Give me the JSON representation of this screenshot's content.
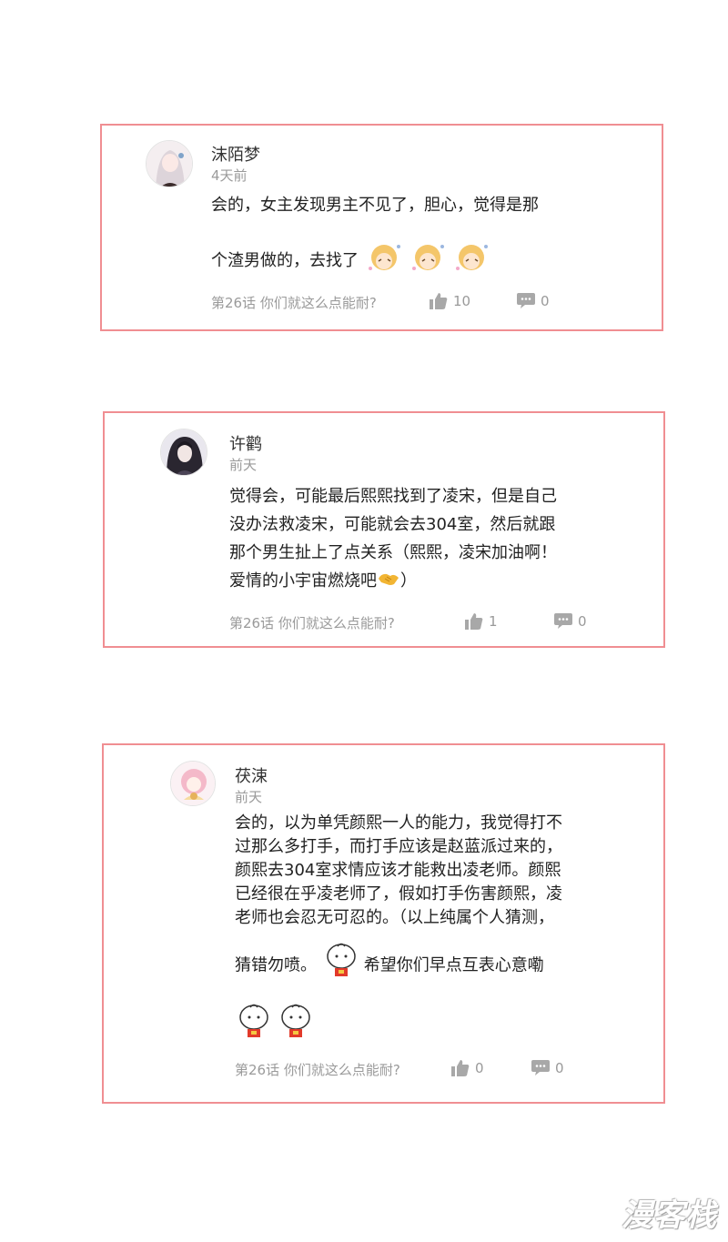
{
  "comments": [
    {
      "user": "沫陌梦",
      "time": "4天前",
      "lines": [
        "会的，女主发现男主不见了，胆心，觉得是那",
        "个渣男做的，去找了"
      ],
      "chapter": "第26话 你们就这么点能耐?",
      "likes": "10",
      "replies": "0"
    },
    {
      "user": "许鹳",
      "time": "前天",
      "lines": [
        "觉得会，可能最后熙熙找到了凌宋，但是自己",
        "没办法救凌宋，可能就会去304室，然后就跟",
        "那个男生扯上了点关系（熙熙，凌宋加油啊！",
        "爱情的小宇宙燃烧吧",
        "）"
      ],
      "chapter": "第26话 你们就这么点能耐?",
      "likes": "1",
      "replies": "0"
    },
    {
      "user": "茯涑",
      "time": "前天",
      "lines": [
        "会的，以为单凭颜熙一人的能力，我觉得打不",
        "过那么多打手，而打手应该是赵蓝派过来的，",
        "颜熙去304室求情应该才能救出凌老师。颜熙",
        "已经很在乎凌老师了，假如打手伤害颜熙，凌",
        "老师也会忍无可忍的。（以上纯属个人猜测，",
        "猜错勿喷。",
        "希望你们早点互表心意嘞"
      ],
      "chapter": "第26话 你们就这么点能耐?",
      "likes": "0",
      "replies": "0"
    }
  ],
  "watermark": "漫客栈",
  "icons": {
    "like": "thumbs-up-icon",
    "reply": "comment-icon"
  },
  "colors": {
    "border": "#f08e92",
    "muted": "#9a9a9a"
  }
}
